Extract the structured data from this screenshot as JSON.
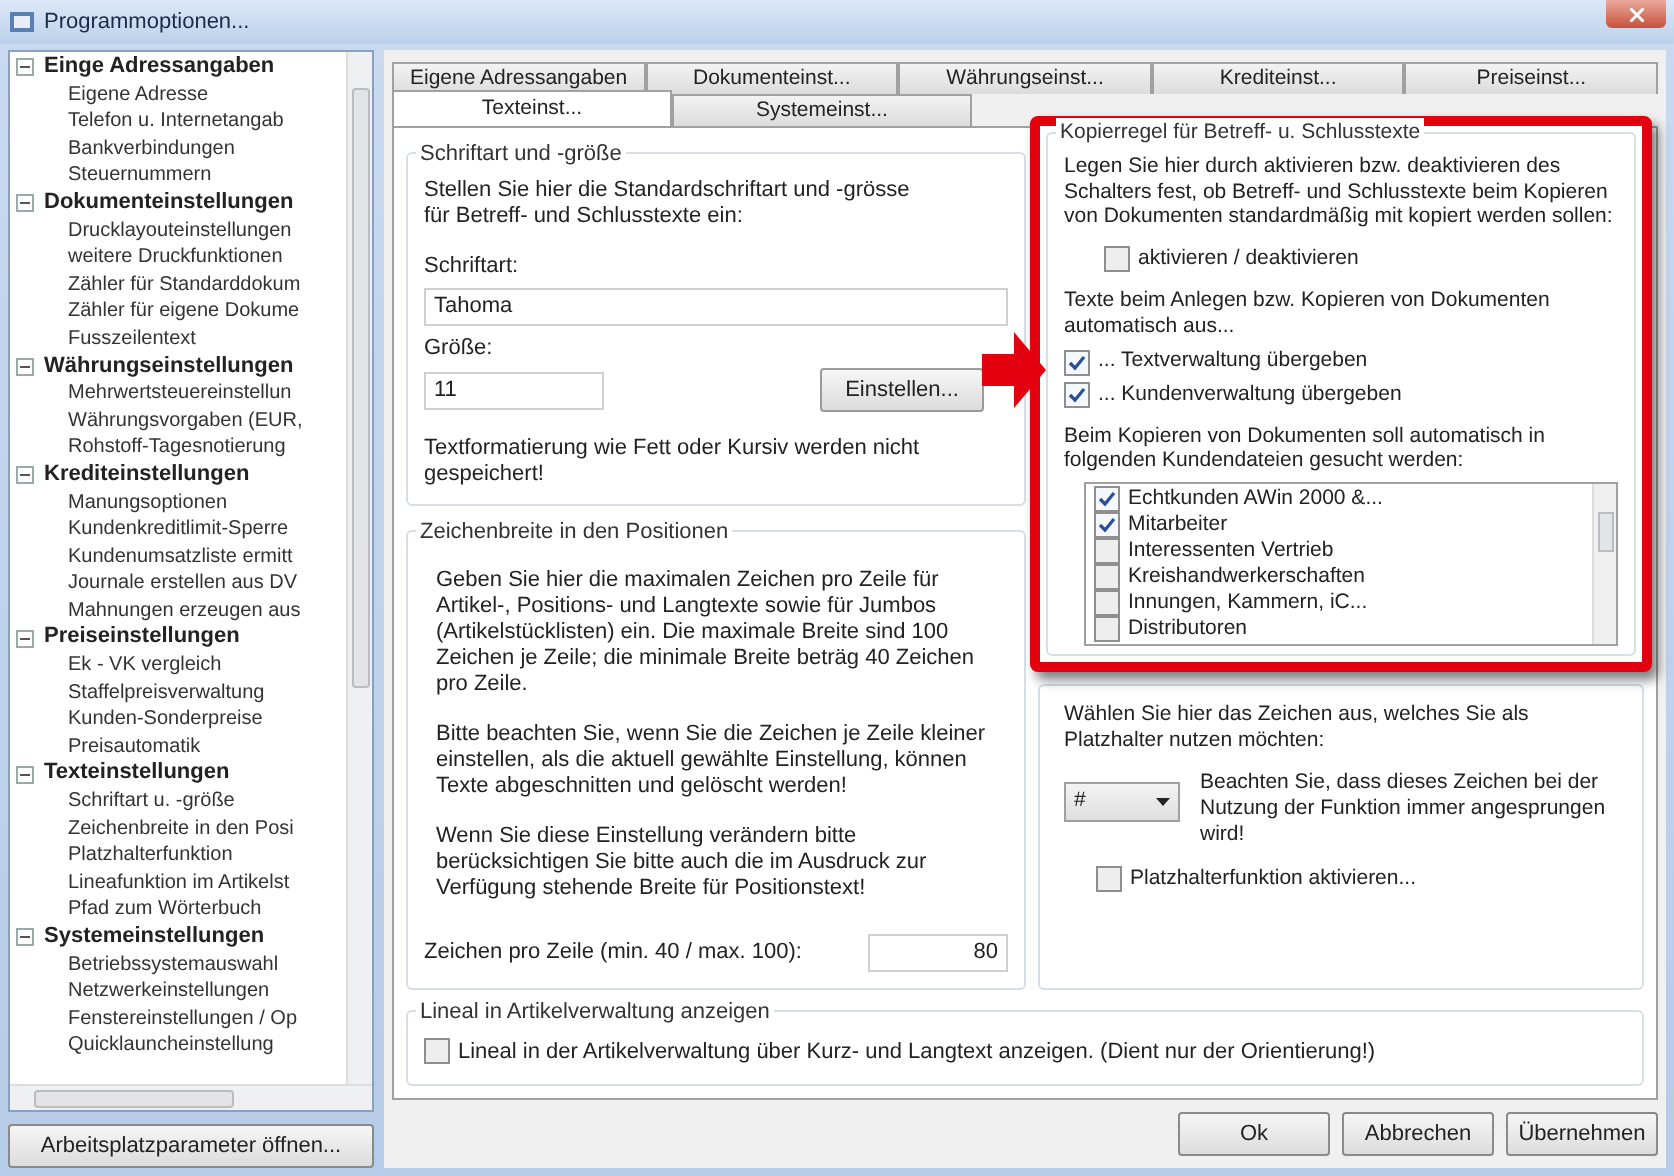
{
  "window": {
    "title": "Programmoptionen..."
  },
  "tree": [
    {
      "label": "Einge Adressangaben",
      "expanded": true,
      "children": [
        {
          "label": "Eigene Adresse"
        },
        {
          "label": "Telefon u. Internetangab"
        },
        {
          "label": "Bankverbindungen"
        },
        {
          "label": "Steuernummern"
        }
      ]
    },
    {
      "label": "Dokumenteinstellungen",
      "expanded": true,
      "children": [
        {
          "label": "Drucklayouteinstellungen"
        },
        {
          "label": "weitere Druckfunktionen"
        },
        {
          "label": "Zähler für Standarddokum"
        },
        {
          "label": "Zähler für eigene Dokume"
        },
        {
          "label": "Fusszeilentext"
        }
      ]
    },
    {
      "label": "Währungseinstellungen",
      "expanded": true,
      "children": [
        {
          "label": "Mehrwertsteuereinstellun"
        },
        {
          "label": "Währungsvorgaben (EUR,"
        },
        {
          "label": "Rohstoff-Tagesnotierung"
        }
      ]
    },
    {
      "label": "Krediteinstellungen",
      "expanded": true,
      "children": [
        {
          "label": "Manungsoptionen"
        },
        {
          "label": "Kundenkreditlimit-Sperre"
        },
        {
          "label": "Kundenumsatzliste ermitt"
        },
        {
          "label": "Journale erstellen aus DV"
        },
        {
          "label": "Mahnungen erzeugen aus"
        }
      ]
    },
    {
      "label": "Preiseinstellungen",
      "expanded": true,
      "children": [
        {
          "label": "Ek - VK vergleich"
        },
        {
          "label": "Staffelpreisverwaltung"
        },
        {
          "label": "Kunden-Sonderpreise"
        },
        {
          "label": "Preisautomatik"
        }
      ]
    },
    {
      "label": "Texteinstellungen",
      "expanded": true,
      "children": [
        {
          "label": "Schriftart u. -größe"
        },
        {
          "label": "Zeichenbreite in den Posi"
        },
        {
          "label": "Platzhalterfunktion"
        },
        {
          "label": "Lineafunktion im Artikelst"
        },
        {
          "label": "Pfad zum Wörterbuch"
        }
      ]
    },
    {
      "label": "Systemeinstellungen",
      "expanded": true,
      "children": [
        {
          "label": "Betriebssystemauswahl"
        },
        {
          "label": "Netzwerkeinstellungen"
        },
        {
          "label": "Fenstereinstellungen / Op"
        },
        {
          "label": "Quicklauncheinstellung"
        }
      ]
    }
  ],
  "workstation_button": "Arbeitsplatzparameter öffnen...",
  "tabs_row_1": [
    {
      "label": "Eigene Adressangaben",
      "selected": false
    },
    {
      "label": "Dokumenteinst...",
      "selected": false
    },
    {
      "label": "Währungseinst...",
      "selected": false
    },
    {
      "label": "Krediteinst...",
      "selected": false
    },
    {
      "label": "Preiseinst...",
      "selected": false
    }
  ],
  "tabs_row_2": [
    {
      "label": "Texteinst...",
      "selected": true
    },
    {
      "label": "Systemeinst...",
      "selected": false
    }
  ],
  "font_group": {
    "title": "Schriftart und -größe",
    "intro": "Stellen Sie hier die Standardschriftart und -grösse für Betreff- und Schlusstexte ein:",
    "font_label": "Schriftart:",
    "font_value": "Tahoma",
    "size_label": "Größe:",
    "size_value": "11",
    "set_button": "Einstellen...",
    "note": "Textformatierung wie Fett oder Kursiv werden nicht gespeichert!"
  },
  "width_group": {
    "title": "Zeichenbreite in den Positionen",
    "paragraphs": [
      "Geben Sie hier die maximalen Zeichen pro Zeile für Artikel-, Positions- und Langtexte sowie für Jumbos (Artikelstücklisten) ein. Die maximale Breite sind 100 Zeichen je Zeile; die minimale Breite beträg 40 Zeichen pro Zeile.",
      "Bitte beachten Sie, wenn Sie die Zeichen je Zeile kleiner einstellen, als die aktuell gewählte Einstellung, können Texte abgeschnitten und gelöscht werden!",
      "Wenn Sie diese Einstellung verändern bitte berücksichtigen Sie bitte auch die im Ausdruck zur Verfügung stehende Breite für Positionstext!"
    ],
    "chars_label": "Zeichen pro Zeile (min. 40 / max. 100):",
    "chars_value": "80"
  },
  "copy_group": {
    "title": "Kopierregel für Betreff- u. Schlusstexte",
    "intro": "Legen Sie hier durch aktivieren bzw. deaktivieren des Schalters fest, ob Betreff- und Schlusstexte beim Kopieren von Dokumenten standardmäßig mit kopiert werden sollen:",
    "toggle": {
      "label": "aktivieren / deaktivieren",
      "checked": false
    },
    "transfer_intro": "Texte beim Anlegen bzw. Kopieren von Dokumenten automatisch aus...",
    "transfer_options": [
      {
        "label": "... Textverwaltung übergeben",
        "checked": true
      },
      {
        "label": "... Kundenverwaltung übergeben",
        "checked": true
      }
    ],
    "search_intro": "Beim Kopieren von Dokumenten soll automatisch in folgenden Kundendateien gesucht werden:",
    "customer_files": [
      {
        "label": "Echtkunden AWin 2000 &...",
        "checked": true
      },
      {
        "label": "Mitarbeiter",
        "checked": true
      },
      {
        "label": "Interessenten Vertrieb",
        "checked": false
      },
      {
        "label": "Kreishandwerkerschaften",
        "checked": false
      },
      {
        "label": "Innungen, Kammern, iC...",
        "checked": false
      },
      {
        "label": "Distributoren",
        "checked": false
      }
    ]
  },
  "placeholder_group": {
    "intro": "Wählen Sie hier das Zeichen aus, welches Sie als Platzhalter nutzen möchten:",
    "char_value": "#",
    "note": "Beachten Sie, dass dieses Zeichen bei der Nutzung der Funktion immer angesprungen wird!",
    "enable": {
      "label": "Platzhalterfunktion aktivieren...",
      "checked": false
    }
  },
  "ruler_group": {
    "title": "Lineal in Artikelverwaltung anzeigen",
    "option": {
      "label": "Lineal in der Artikelverwaltung über Kurz- und Langtext anzeigen. (Dient nur der Orientierung!)",
      "checked": false
    }
  },
  "buttons": [
    "Ok",
    "Abbrechen",
    "Übernehmen"
  ]
}
